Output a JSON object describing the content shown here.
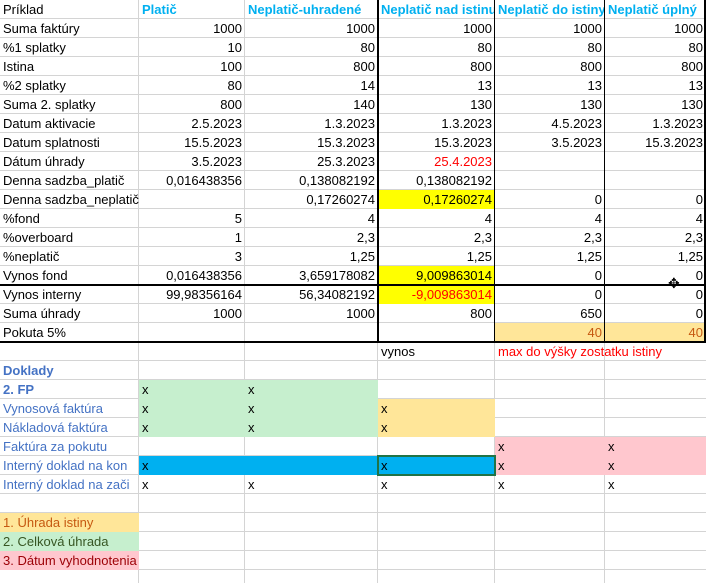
{
  "colors": {
    "header_blue": "#00b0f0",
    "yellow": "#ffff00",
    "green": "#c6efce",
    "orange": "#ffe699",
    "pink": "#ffc7ce",
    "blue_fill": "#00b0f0",
    "red_text": "#ff0000",
    "doklady_blue": "#4472c4"
  },
  "headers": [
    "Príklad",
    "Platič",
    "Neplatič-uhradené",
    "Neplatič nad istinu",
    "Neplatič do istiny",
    "Neplatič úplný"
  ],
  "rows": [
    [
      "Suma faktúry",
      "1000",
      "1000",
      "1000",
      "1000",
      "1000"
    ],
    [
      "%1 splatky",
      "10",
      "80",
      "80",
      "80",
      "80"
    ],
    [
      "Istina",
      "100",
      "800",
      "800",
      "800",
      "800"
    ],
    [
      "%2 splatky",
      "80",
      "14",
      "13",
      "13",
      "13"
    ],
    [
      "Suma 2. splatky",
      "800",
      "140",
      "130",
      "130",
      "130"
    ],
    [
      "Datum aktivacie",
      "2.5.2023",
      "1.3.2023",
      "1.3.2023",
      "4.5.2023",
      "1.3.2023"
    ],
    [
      "Datum splatnosti",
      "15.5.2023",
      "15.3.2023",
      "15.3.2023",
      "3.5.2023",
      "15.3.2023"
    ],
    [
      "Dátum úhrady",
      "3.5.2023",
      "25.3.2023",
      "25.4.2023",
      "",
      ""
    ],
    [
      "Denna sadzba_platič",
      "0,016438356",
      "0,138082192",
      "0,138082192",
      "",
      ""
    ],
    [
      "Denna sadzba_neplatič",
      "",
      "0,17260274",
      "0,17260274",
      "0",
      "0"
    ],
    [
      "%fond",
      "5",
      "4",
      "4",
      "4",
      "4"
    ],
    [
      "%overboard",
      "1",
      "2,3",
      "2,3",
      "2,3",
      "2,3"
    ],
    [
      "%neplatič",
      "3",
      "1,25",
      "1,25",
      "1,25",
      "1,25"
    ],
    [
      "Vynos fond",
      "0,016438356",
      "3,659178082",
      "9,009863014",
      "0",
      "0"
    ],
    [
      "Vynos interny",
      "99,98356164",
      "56,34082192",
      "-9,009863014",
      "0",
      "0"
    ],
    [
      "Suma úhrady",
      "1000",
      "1000",
      "800",
      "650",
      "0"
    ],
    [
      "Pokuta 5%",
      "",
      "",
      "",
      "40",
      "40"
    ]
  ],
  "notes": {
    "vynos": "vynos",
    "max": "max do výšky zostatku istiny"
  },
  "doklady": {
    "title": "Doklady",
    "rows": [
      {
        "label": "2. FP",
        "c1": "x",
        "c2": "x",
        "c3": "",
        "c4": "",
        "c5": ""
      },
      {
        "label": "Vynosová faktúra",
        "c1": "x",
        "c2": "x",
        "c3": "x",
        "c4": "",
        "c5": ""
      },
      {
        "label": "Nákladová faktúra",
        "c1": "x",
        "c2": "x",
        "c3": "x",
        "c4": "",
        "c5": ""
      },
      {
        "label": "Faktúra za pokutu",
        "c1": "",
        "c2": "",
        "c3": "",
        "c4": "x",
        "c5": "x"
      },
      {
        "label": "Interný doklad na kon",
        "c1": "x",
        "c2": "",
        "c3": "x",
        "c4": "x",
        "c5": "x"
      },
      {
        "label": "Interný doklad na zači",
        "c1": "x",
        "c2": "x",
        "c3": "x",
        "c4": "x",
        "c5": "x"
      }
    ]
  },
  "legend": [
    "1. Úhrada istiny",
    "2. Celková úhrada",
    "3. Dátum vyhodnotenia"
  ]
}
